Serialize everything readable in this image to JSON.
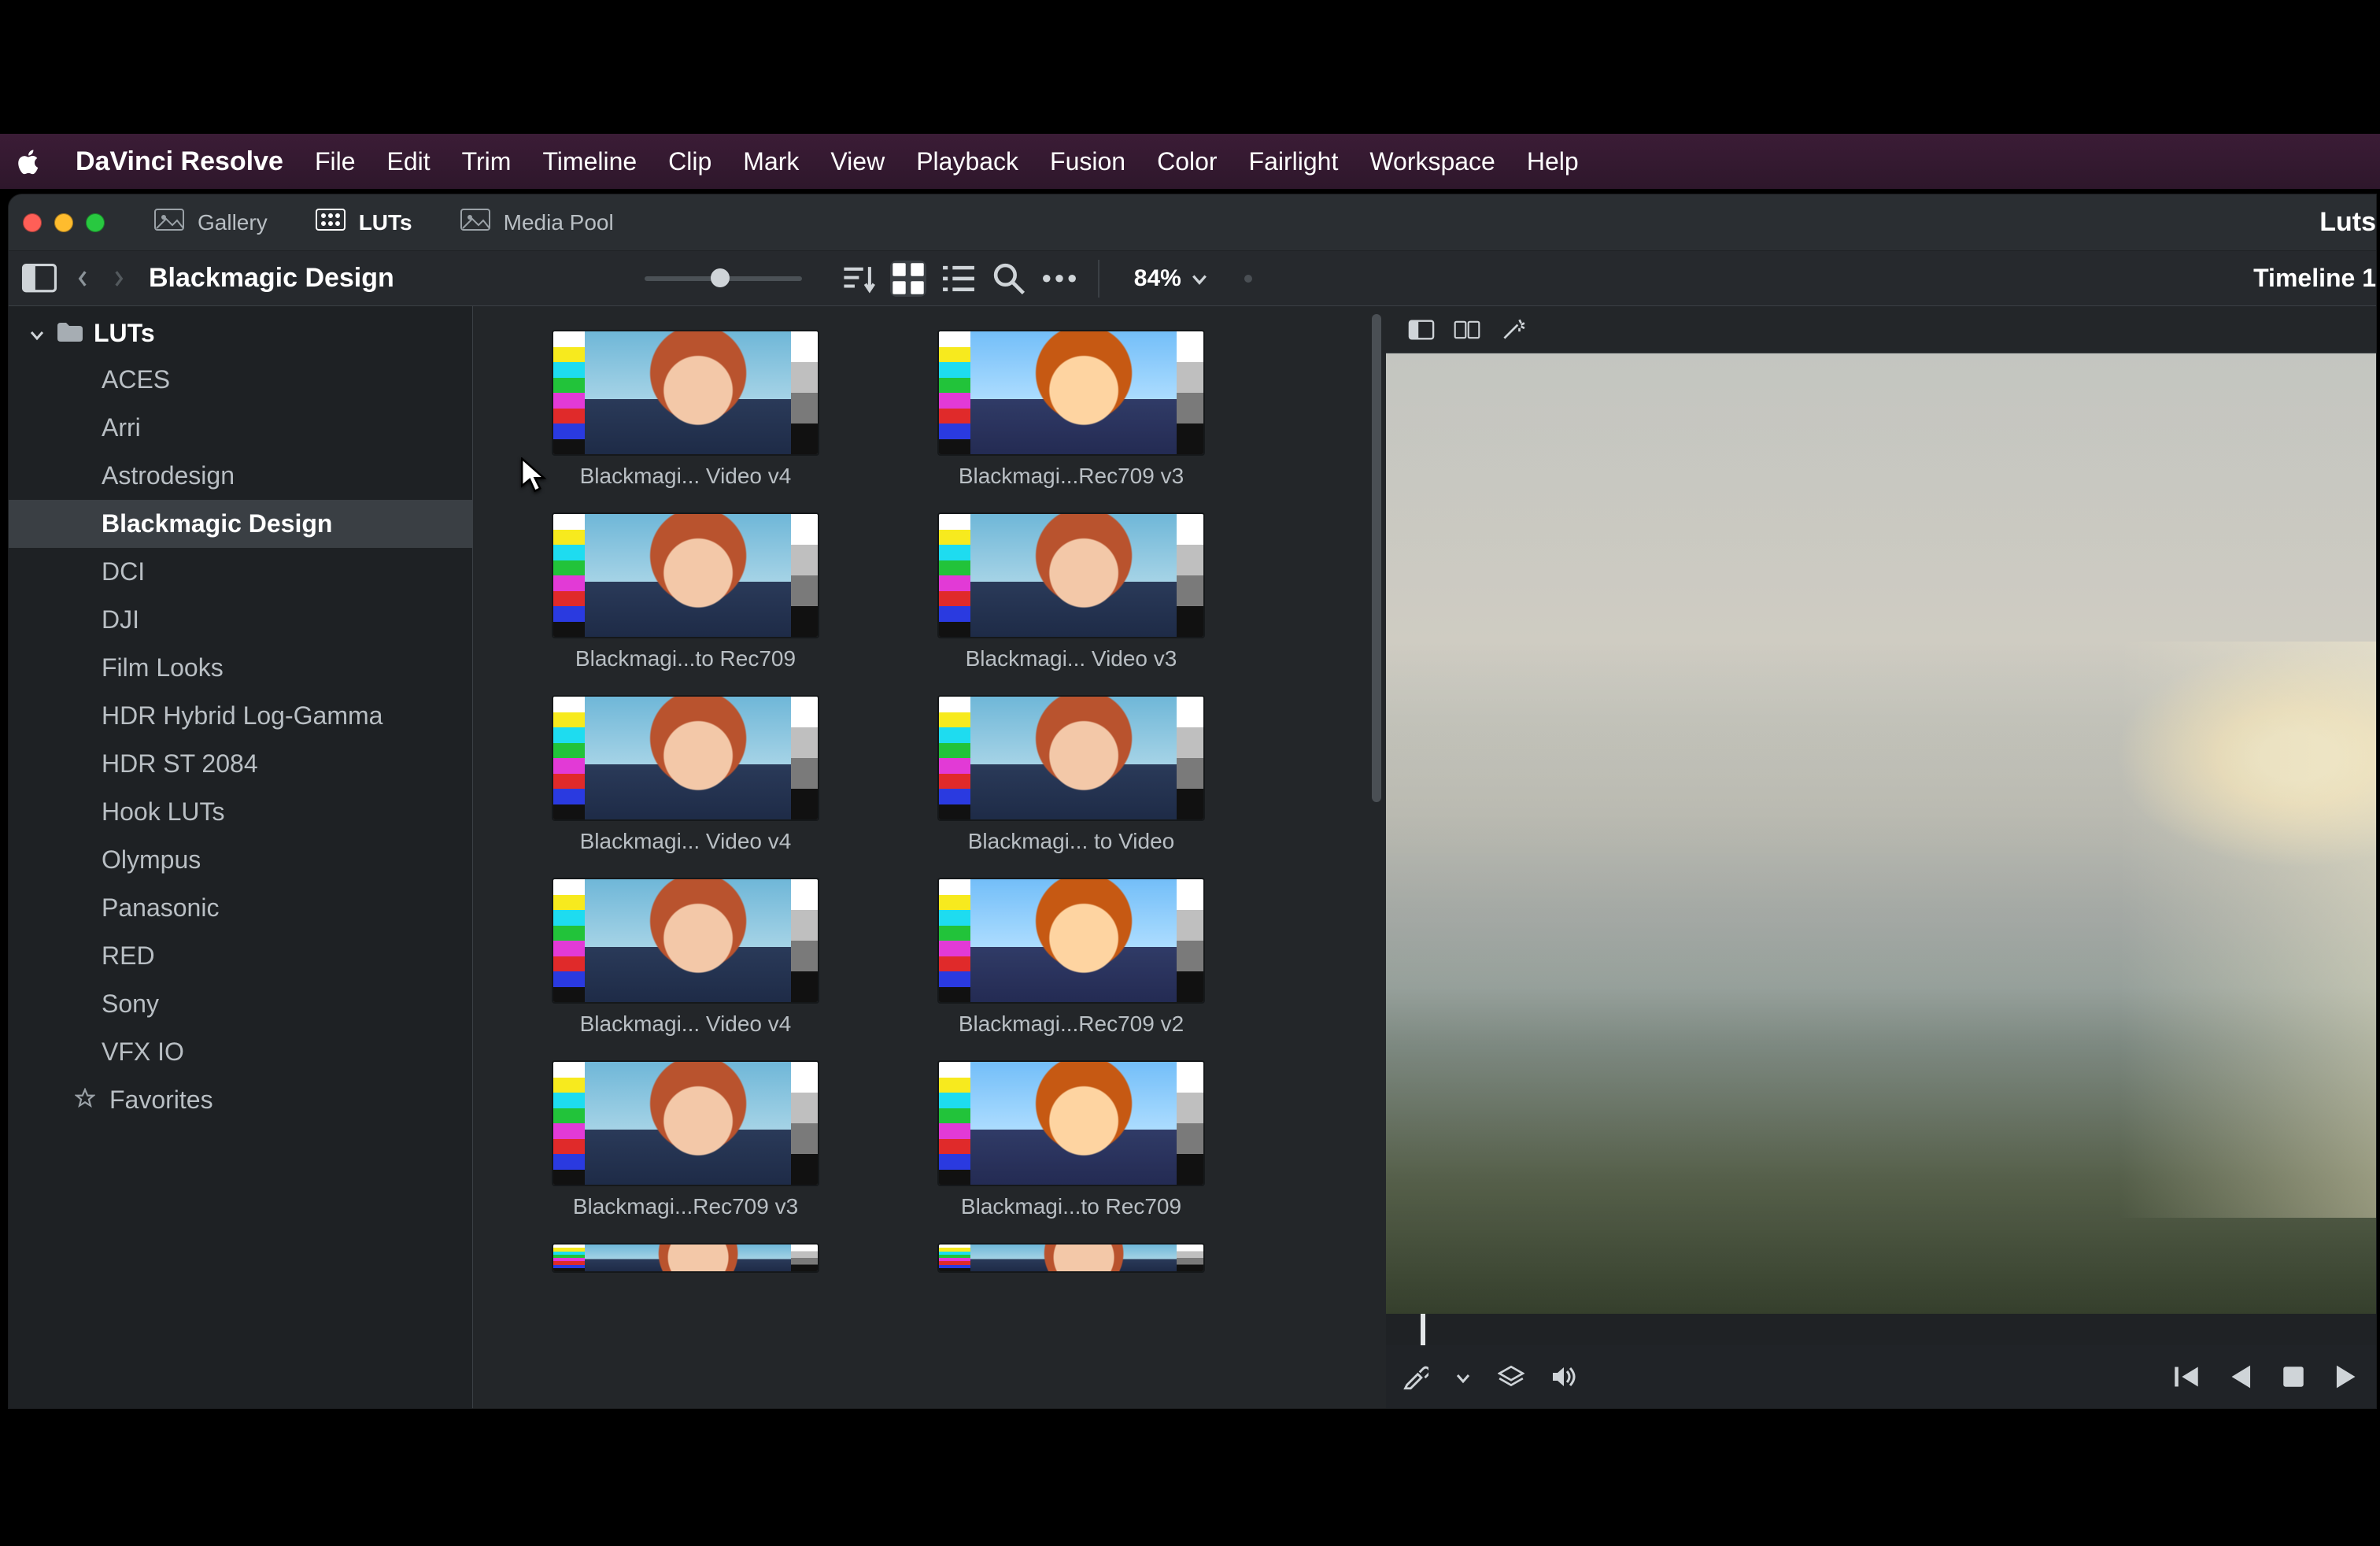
{
  "menubar": {
    "app": "DaVinci Resolve",
    "items": [
      "File",
      "Edit",
      "Trim",
      "Timeline",
      "Clip",
      "Mark",
      "View",
      "Playback",
      "Fusion",
      "Color",
      "Fairlight",
      "Workspace",
      "Help"
    ]
  },
  "titlebar": {
    "tabs": [
      {
        "label": "Gallery",
        "icon": "image-icon",
        "active": false
      },
      {
        "label": "LUTs",
        "icon": "grid-icon",
        "active": true
      },
      {
        "label": "Media Pool",
        "icon": "image-icon",
        "active": false
      }
    ],
    "right_title": "Luts"
  },
  "toolbar": {
    "breadcrumb": "Blackmagic Design",
    "slider_pos": 0.48,
    "zoom": "84%",
    "right_label": "Timeline 1"
  },
  "sidebar": {
    "root": "LUTs",
    "folders": [
      "ACES",
      "Arri",
      "Astrodesign",
      "Blackmagic Design",
      "DCI",
      "DJI",
      "Film Looks",
      "HDR Hybrid Log-Gamma",
      "HDR ST 2084",
      "Hook LUTs",
      "Olympus",
      "Panasonic",
      "RED",
      "Sony",
      "VFX IO"
    ],
    "selected_index": 3,
    "favorites_label": "Favorites"
  },
  "luts": {
    "items": [
      {
        "label": "Blackmagi... Video v4",
        "tone": "neutral"
      },
      {
        "label": "Blackmagi...Rec709 v3",
        "tone": "warm"
      },
      {
        "label": "Blackmagi...to Rec709",
        "tone": "neutral"
      },
      {
        "label": "Blackmagi... Video v3",
        "tone": "neutral"
      },
      {
        "label": "Blackmagi... Video v4",
        "tone": "neutral"
      },
      {
        "label": "Blackmagi... to Video",
        "tone": "neutral"
      },
      {
        "label": "Blackmagi... Video v4",
        "tone": "neutral"
      },
      {
        "label": "Blackmagi...Rec709 v2",
        "tone": "warm"
      },
      {
        "label": "Blackmagi...Rec709 v3",
        "tone": "neutral"
      },
      {
        "label": "Blackmagi...to Rec709",
        "tone": "warm"
      }
    ]
  },
  "viewer": {
    "scrub_pos": 0.035
  },
  "colors": {
    "bar_colors": [
      "#ffffff",
      "#f7ea1e",
      "#1edcf0",
      "#22c33a",
      "#e23ad6",
      "#e02a2a",
      "#2a3ae0",
      "#111111"
    ]
  }
}
